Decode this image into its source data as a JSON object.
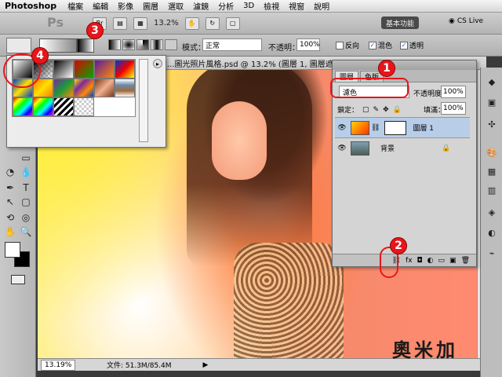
{
  "menubar": {
    "app": "Photoshop",
    "items": [
      "檔案",
      "編輯",
      "影像",
      "圖層",
      "選取",
      "濾鏡",
      "分析",
      "3D",
      "檢視",
      "視窗",
      "說明"
    ]
  },
  "appbar": {
    "ps": "Ps",
    "br": "Br",
    "zoom": "13.2%",
    "workspace": "基本功能",
    "cslive": "CS Live"
  },
  "options": {
    "mode_label": "模式：",
    "mode_value": "正常",
    "opacity_label": "不透明：",
    "opacity_value": "100%",
    "reverse_label": "反向",
    "dither_label": "混色",
    "transparency_label": "透明"
  },
  "document": {
    "title": "...圖光照片風格.psd @ 13.2% (圖層 1, 圖層遮色片/8) *",
    "status_zoom": "13.19%",
    "status_file": "文件: 51.3M/85.4M"
  },
  "layers_panel": {
    "tabs": [
      "圖層",
      "色版"
    ],
    "blend_mode": "濾色",
    "opacity_label": "不透明度：",
    "opacity_value": "100%",
    "lock_label": "鎖定：",
    "fill_label": "填滿：",
    "fill_value": "100%",
    "layers": [
      {
        "name": "圖層 1"
      },
      {
        "name": "背景"
      }
    ],
    "bottom_fx": "fx"
  },
  "callouts": [
    "1",
    "2",
    "3",
    "4"
  ],
  "logo": "奧米加",
  "colors": {
    "callout_red": "#e8151b",
    "selected_layer": "#b8cde8"
  }
}
